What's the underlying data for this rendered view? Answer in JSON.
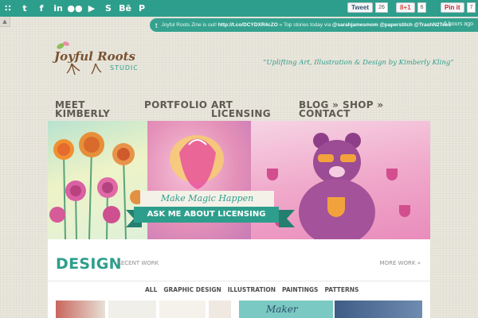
{
  "social_icons": [
    {
      "name": "rss-icon",
      "glyph": "∷"
    },
    {
      "name": "twitter-icon",
      "glyph": "t"
    },
    {
      "name": "facebook-icon",
      "glyph": "f"
    },
    {
      "name": "linkedin-icon",
      "glyph": "in"
    },
    {
      "name": "flickr-icon",
      "glyph": "●●"
    },
    {
      "name": "youtube-icon",
      "glyph": "▶"
    },
    {
      "name": "skype-icon",
      "glyph": "S"
    },
    {
      "name": "behance-icon",
      "glyph": "Bē"
    },
    {
      "name": "pinterest-icon",
      "glyph": "P"
    }
  ],
  "share": {
    "tweet": {
      "label": "Tweet",
      "count": "26"
    },
    "gplus": {
      "label": "8+1",
      "count": "6"
    },
    "pin": {
      "label": "Pin it",
      "count": "7"
    }
  },
  "ticker": {
    "text": "Joyful Roots Zine is out!",
    "link": "http://t.co/DCYDXR4cZO",
    "rest": "» Top stories today via",
    "mentions": "@sarahjamesmom @paperstitch @TrashN2Tees",
    "ago": "6 hours ago"
  },
  "logo": {
    "line1": "Joyful Roots",
    "line2": "STUDIO"
  },
  "tagline": "“Uplifting Art, Illustration & Design by Kimberly Kling”",
  "nav": {
    "meet": "MEET KIMBERLY",
    "portfolio": "PORTFOLIO",
    "art": "ART LICENSING",
    "blog": "BLOG »",
    "shop": "SHOP »",
    "contact": "CONTACT"
  },
  "hero": {
    "banner_top": "Make Magic Happen",
    "banner_bottom": "ASK ME ABOUT LICENSING"
  },
  "section": {
    "title": "DESIGN",
    "subtitle": "RECENT WORK",
    "more": "MORE WORK »",
    "filters": [
      "ALL",
      "GRAPHIC DESIGN",
      "ILLUSTRATION",
      "PAINTINGS",
      "PATTERNS"
    ],
    "thumb_text": "Maker"
  },
  "colors": {
    "accent": "#2e9e8c",
    "nav_text": "#5f5a52",
    "logo_brown": "#7a5230"
  }
}
